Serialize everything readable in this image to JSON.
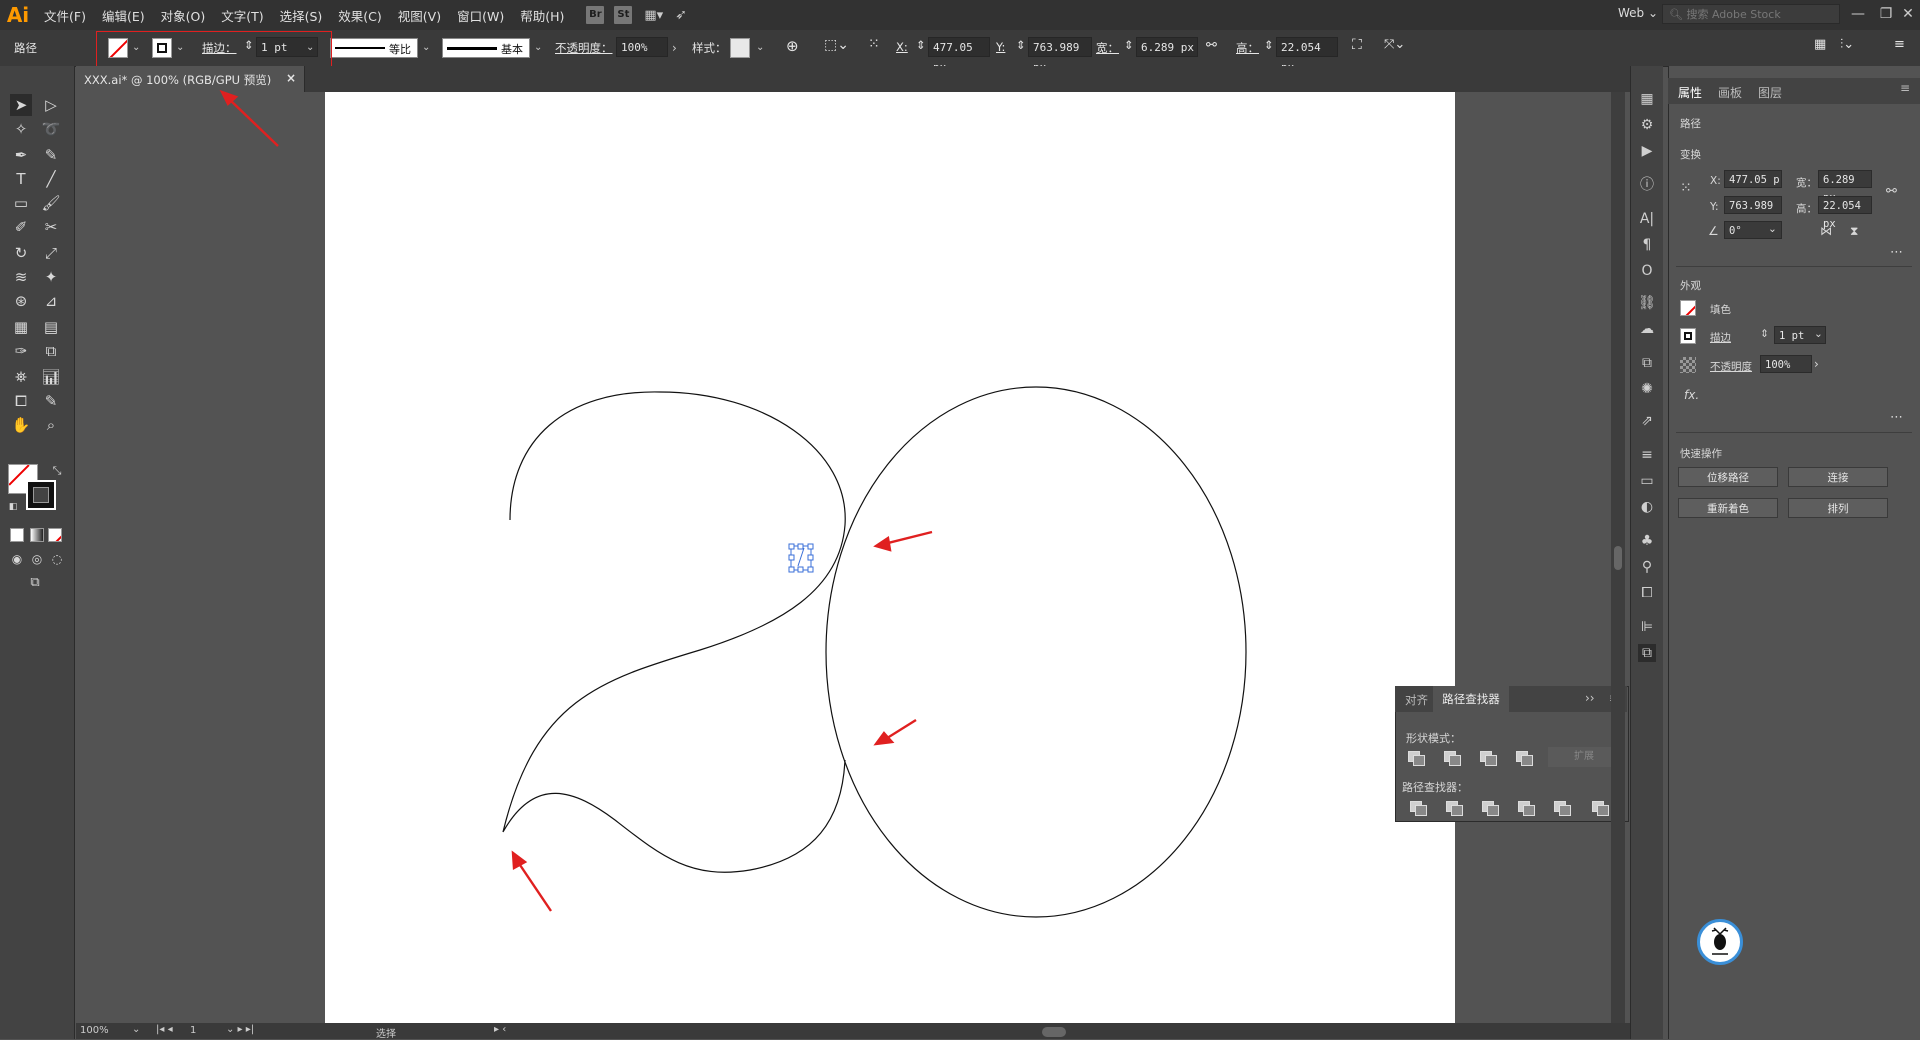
{
  "app": {
    "logo": "Ai",
    "workspace": "Web",
    "search_placeholder": "搜索 Adobe Stock"
  },
  "menu": [
    "文件(F)",
    "编辑(E)",
    "对象(O)",
    "文字(T)",
    "选择(S)",
    "效果(C)",
    "视图(V)",
    "窗口(W)",
    "帮助(H)"
  ],
  "menu_icons": {
    "bridge": "Br",
    "stock": "St"
  },
  "control": {
    "selection_label": "路径",
    "stroke_label": "描边：",
    "stroke_weight": "1 pt",
    "profile_label": "等比",
    "brush_label": "基本",
    "opacity_label": "不透明度：",
    "opacity_value": "100%",
    "style_label": "样式：",
    "x_label": "X:",
    "x_value": "477.05 px",
    "y_label": "Y:",
    "y_value": "763.989 px",
    "w_label": "宽：",
    "w_value": "6.289 px",
    "h_label": "高：",
    "h_value": "22.054 px"
  },
  "document": {
    "tab_title": "XXX.ai* @ 100% (RGB/GPU 预览)",
    "close": "×"
  },
  "status": {
    "zoom": "100%",
    "page": "1",
    "tool": "选择"
  },
  "pathfinder": {
    "tabs": [
      "对齐",
      "路径查找器"
    ],
    "shape_modes_label": "形状模式：",
    "expand_label": "扩展",
    "pathfinders_label": "路径查找器："
  },
  "properties": {
    "tabs": [
      "属性",
      "画板",
      "图层"
    ],
    "object_type": "路径",
    "transform_label": "变换",
    "x_label": "X:",
    "x_value": "477.05 p",
    "y_label": "Y:",
    "y_value": "763.989",
    "w_label": "宽：",
    "w_value": "6.289 px",
    "h_label": "高：",
    "h_value": "22.054 px",
    "angle_value": "0°",
    "appearance_label": "外观",
    "fill_label": "填色",
    "stroke_label": "描边",
    "stroke_value": "1 pt",
    "opacity_label": "不透明度",
    "opacity_value": "100%",
    "fx_label": "fx.",
    "quick_actions_label": "快速操作",
    "buttons": [
      "位移路径",
      "连接",
      "重新着色",
      "排列"
    ]
  },
  "colors": {
    "annotation_red": "#e02020",
    "selection_blue": "#3a6fd8",
    "ui_dark": "#323232",
    "ui_mid": "#535353"
  }
}
